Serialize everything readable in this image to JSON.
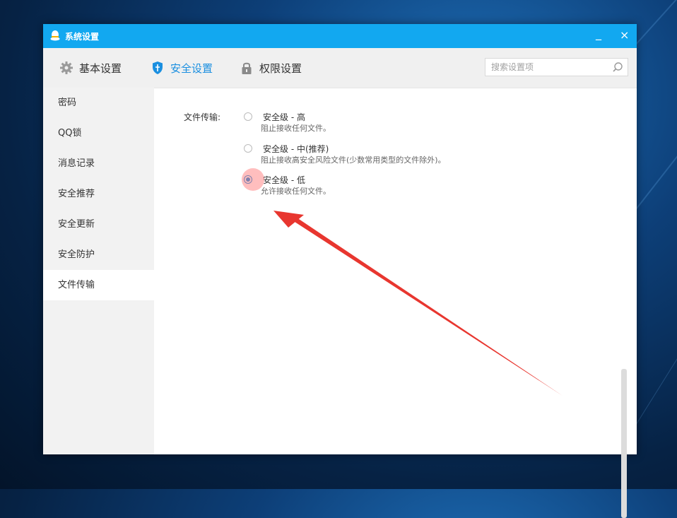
{
  "window": {
    "title": "系统设置",
    "minimize": "_",
    "close": "×"
  },
  "toolbar": {
    "tabs": [
      {
        "label": "基本设置",
        "icon": "gear-icon"
      },
      {
        "label": "安全设置",
        "icon": "shield-icon",
        "active": true
      },
      {
        "label": "权限设置",
        "icon": "lock-icon"
      }
    ],
    "search_placeholder": "搜索设置项"
  },
  "sidebar": {
    "items": [
      {
        "label": "密码"
      },
      {
        "label": "QQ锁"
      },
      {
        "label": "消息记录"
      },
      {
        "label": "安全推荐"
      },
      {
        "label": "安全更新"
      },
      {
        "label": "安全防护"
      },
      {
        "label": "文件传输",
        "active": true
      }
    ]
  },
  "file_transfer": {
    "label": "文件传输:",
    "options": [
      {
        "label": "安全级 - 高",
        "description": "阻止接收任何文件。",
        "checked": false
      },
      {
        "label": "安全级 - 中(推荐)",
        "description": "阻止接收高安全风险文件(少数常用类型的文件除外)。",
        "checked": false
      },
      {
        "label": "安全级 - 低",
        "description": "允许接收任何文件。",
        "checked": true
      }
    ]
  },
  "colors": {
    "titlebar": "#12a8f0",
    "accent": "#1a8fe0",
    "annotation_arrow": "#e8362f"
  }
}
